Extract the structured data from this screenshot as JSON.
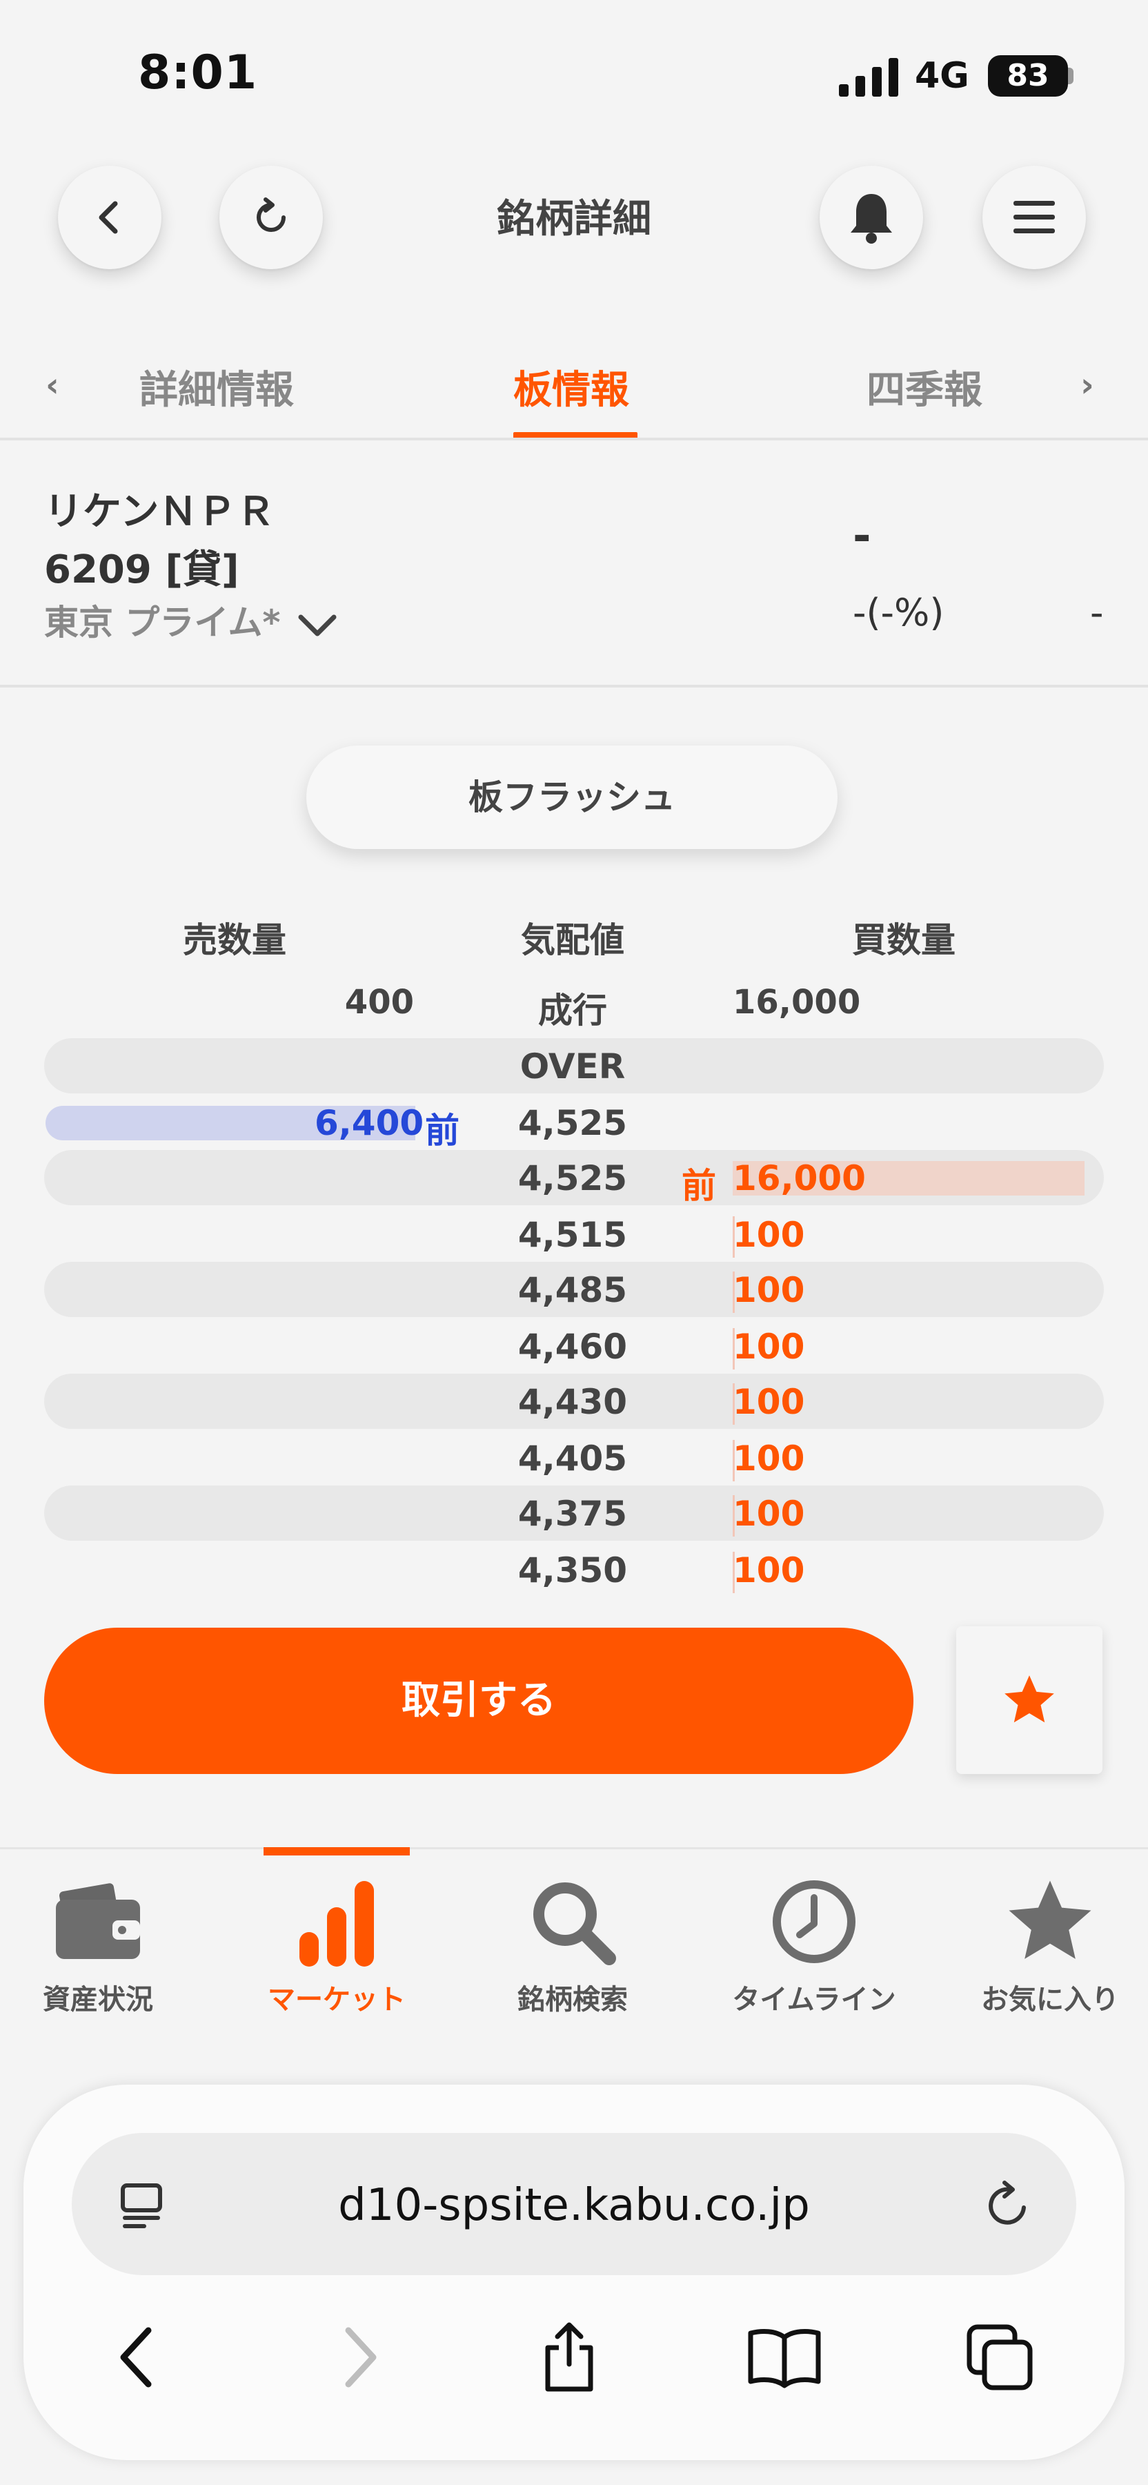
{
  "status": {
    "time": "8:01",
    "network": "4G",
    "battery": "83"
  },
  "header": {
    "title": "銘柄詳細"
  },
  "tabs": {
    "prev_arrow": "‹",
    "next_arrow": "›",
    "items": [
      "詳細情報",
      "板情報",
      "四季報"
    ],
    "active": "板情報"
  },
  "stock": {
    "name": "リケンＮＰＲ",
    "code": "6209 [貸]",
    "market": "東京 プライム*",
    "price": "-",
    "change": "-(-%)",
    "volume": "-"
  },
  "flash_button": "板フラッシュ",
  "board": {
    "headers": {
      "sell": "売数量",
      "price": "気配値",
      "buy": "買数量"
    },
    "market_order": {
      "sell": "400",
      "label": "成行",
      "buy": "16,000"
    },
    "over_label": "OVER",
    "sell_row": {
      "qty": "6,400",
      "mae": "前",
      "price": "4,525",
      "bar_fraction": 1.0
    },
    "buy_row": {
      "qty": "16,000",
      "mae": "前",
      "price": "4,525",
      "bar_fraction": 1.0
    },
    "rows": [
      {
        "price": "4,515",
        "buy": "100"
      },
      {
        "price": "4,485",
        "buy": "100"
      },
      {
        "price": "4,460",
        "buy": "100"
      },
      {
        "price": "4,430",
        "buy": "100"
      },
      {
        "price": "4,405",
        "buy": "100"
      },
      {
        "price": "4,375",
        "buy": "100"
      },
      {
        "price": "4,350",
        "buy": "100"
      }
    ]
  },
  "trade_button": "取引する",
  "nav": [
    {
      "label": "資産状況",
      "icon": "wallet-icon"
    },
    {
      "label": "マーケット",
      "icon": "bar-chart-icon",
      "active": true
    },
    {
      "label": "銘柄検索",
      "icon": "search-icon"
    },
    {
      "label": "タイムライン",
      "icon": "clock-icon"
    },
    {
      "label": "お気に入り",
      "icon": "star-icon"
    }
  ],
  "browser": {
    "url": "d10-spsite.kabu.co.jp"
  },
  "colors": {
    "accent": "#ff5500",
    "sell": "#2548d8",
    "sell_bar": "#cfd3ee",
    "buy_bar": "#f0d4ca"
  }
}
